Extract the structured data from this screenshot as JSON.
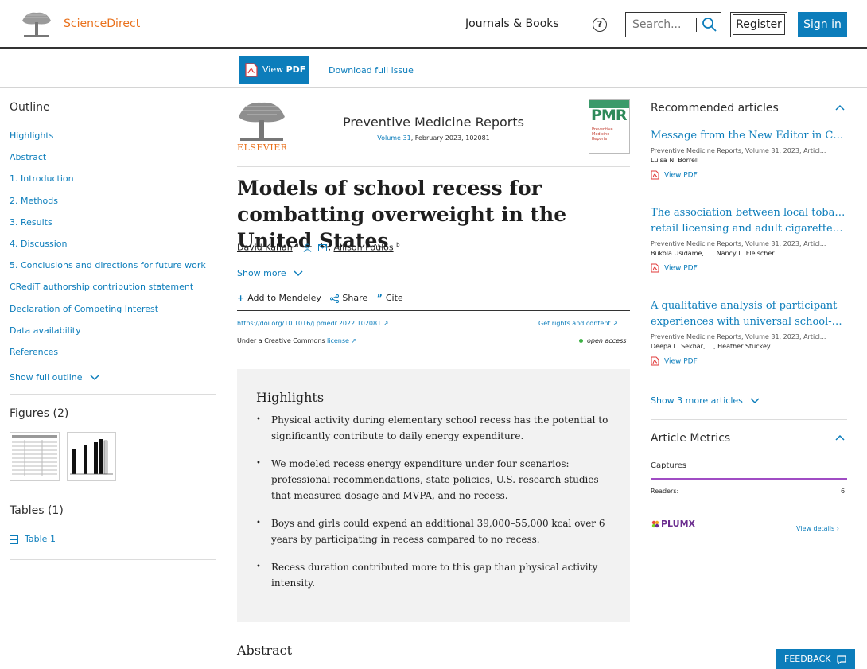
{
  "header": {
    "brand": "ScienceDirect",
    "nav_journals": "Journals & Books",
    "help_symbol": "?",
    "search_placeholder": "Search...",
    "register_label": "Register",
    "signin_label": "Sign in"
  },
  "toolbar": {
    "view_pdf_prefix": "View ",
    "view_pdf_bold": "PDF",
    "download_issue": "Download full issue"
  },
  "outline": {
    "title": "Outline",
    "items": [
      "Highlights",
      "Abstract",
      "1. Introduction",
      "2. Methods",
      "3. Results",
      "4. Discussion",
      "5. Conclusions and directions for future work",
      "CRediT authorship contribution statement",
      "Declaration of Competing Interest",
      "Data availability",
      "References"
    ],
    "show_full": "Show full outline"
  },
  "figures": {
    "title": "Figures (2)"
  },
  "tables": {
    "title": "Tables (1)",
    "items": [
      "Table 1"
    ]
  },
  "article": {
    "publisher": "ELSEVIER",
    "journal": "Preventive Medicine Reports",
    "volume_link": "Volume 31",
    "volume_rest": ", February 2023, 102081",
    "cover_abbr": "PMR",
    "cover_text": "Preventive Medicine Reports",
    "title": "Models of school recess for combatting overweight in the United States",
    "author1": "David Kahan",
    "author1_sup": "a",
    "author_sep": ",",
    "author2": "Allison Poulos",
    "author2_sup": "b",
    "show_more": "Show more",
    "action_mendeley": "Add to Mendeley",
    "action_share": "Share",
    "action_cite": "Cite",
    "doi": "https://doi.org/10.1016/j.pmedr.2022.102081",
    "rights": "Get rights and content",
    "cc_prefix": "Under a Creative Commons ",
    "cc_link": "license",
    "open_access": "open access"
  },
  "highlights": {
    "title": "Highlights",
    "items": [
      "Physical activity during elementary school recess has the potential to significantly contribute to daily energy expenditure.",
      "We modeled recess energy expenditure under four scenarios: professional recommendations, state policies, U.S. research studies that measured dosage and MVPA, and no recess.",
      "Boys and girls could expend an additional 39,000–55,000 kcal over 6 years by participating in recess compared to no recess.",
      "Recess duration contributed more to this gap than physical activity intensity."
    ]
  },
  "abstract": {
    "title": "Abstract"
  },
  "recommended": {
    "title": "Recommended articles",
    "articles": [
      {
        "title": "Message from the New Editor in Chief",
        "meta": "Preventive Medicine Reports, Volume 31, 2023, Articl...",
        "authors": "Luisa N. Borrell",
        "view_pdf": "View PDF"
      },
      {
        "title1": "The association between local tobacco",
        "title2": "retail licensing and adult cigarette…",
        "meta": "Preventive Medicine Reports, Volume 31, 2023, Articl...",
        "authors": "Bukola Usidame, …, Nancy L. Fleischer",
        "view_pdf": "View PDF"
      },
      {
        "title1": "A qualitative analysis of participant",
        "title2": "experiences with universal school-based…",
        "meta": "Preventive Medicine Reports, Volume 31, 2023, Articl...",
        "authors": "Deepa L. Sekhar, …, Heather Stuckey",
        "view_pdf": "View PDF"
      }
    ],
    "show_more": "Show 3 more articles"
  },
  "metrics": {
    "title": "Article Metrics",
    "captures": "Captures",
    "readers_label": "Readers:",
    "readers_value": "6",
    "plumx": "PLUMX",
    "view_details": "View details"
  },
  "feedback": {
    "label": "FEEDBACK"
  },
  "colors": {
    "accent": "#0c7dbb",
    "brand": "#e9711c",
    "highlight_bg": "#f2f2f2",
    "captures_bar": "#a04cc4"
  }
}
